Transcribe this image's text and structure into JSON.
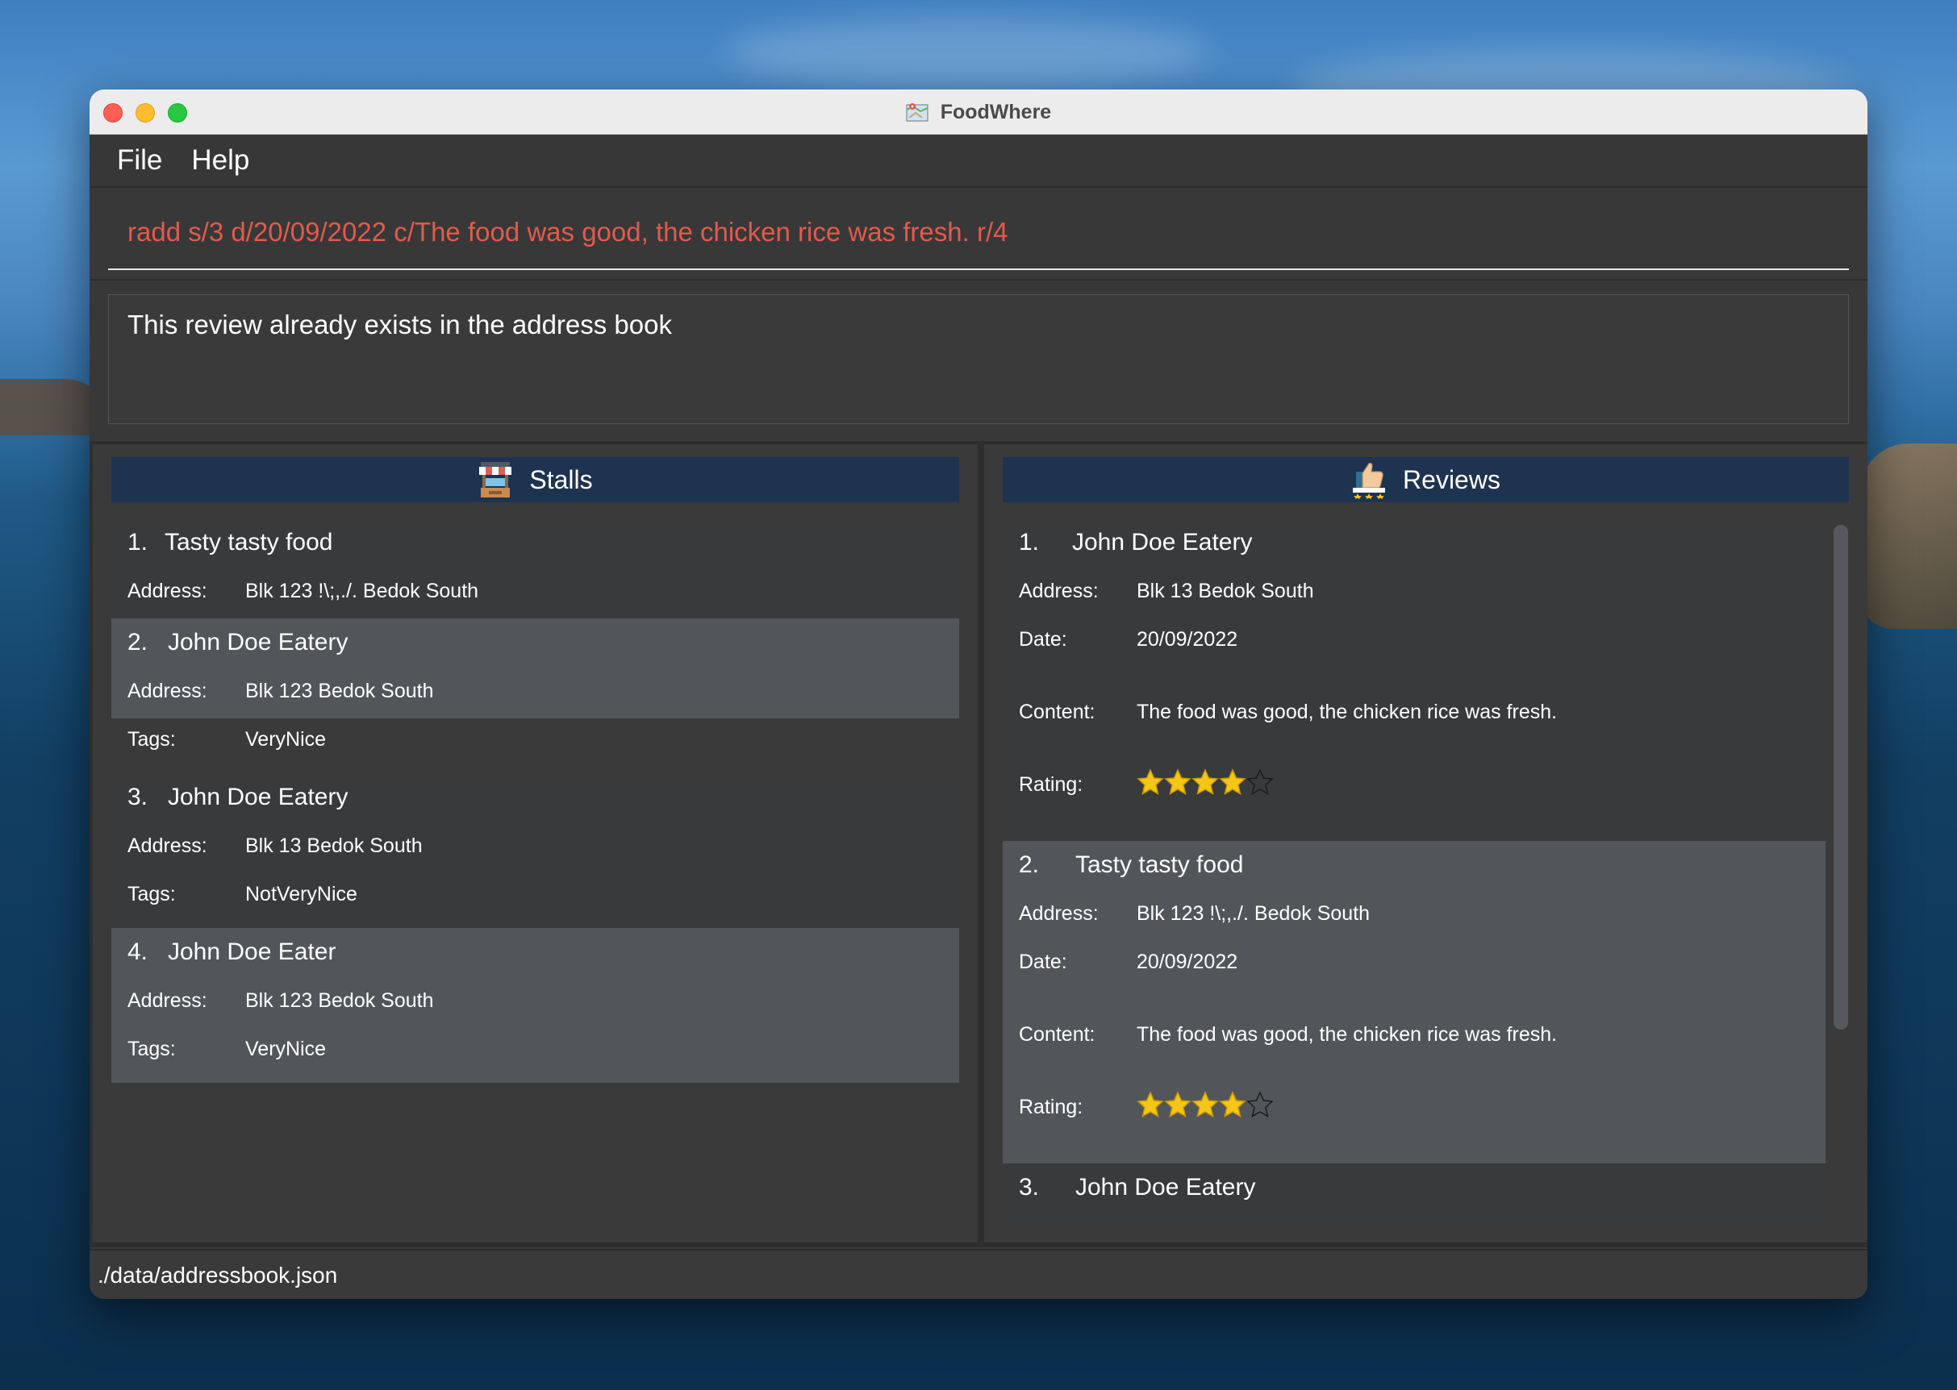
{
  "window": {
    "title": "FoodWhere",
    "app_icon": "map-icon"
  },
  "menu": {
    "file": "File",
    "help": "Help"
  },
  "command": {
    "value": "radd s/3 d/20/09/2022 c/The food was good, the chicken rice was fresh. r/4",
    "error_color": "#e35a4c"
  },
  "result": {
    "message": "This review already exists in the address book"
  },
  "stalls": {
    "header": "Stalls",
    "header_icon": "food-stall-icon",
    "address_label": "Address:",
    "tags_label": "Tags:",
    "items": [
      {
        "index": "1.",
        "name": "Tasty tasty food",
        "address": "Blk 123 !\\;,./. Bedok South",
        "tags": ""
      },
      {
        "index": "2.",
        "name": "John Doe Eatery",
        "address": "Blk 123 Bedok South",
        "tags": "VeryNice"
      },
      {
        "index": "3.",
        "name": "John Doe Eatery",
        "address": "Blk 13 Bedok South",
        "tags": "NotVeryNice"
      },
      {
        "index": "4.",
        "name": "John Doe Eater",
        "address": "Blk 123 Bedok South",
        "tags": "VeryNice"
      }
    ]
  },
  "reviews": {
    "header": "Reviews",
    "header_icon": "thumbs-up-review-icon",
    "address_label": "Address:",
    "date_label": "Date:",
    "content_label": "Content:",
    "rating_label": "Rating:",
    "items": [
      {
        "index": "1.",
        "name": "John Doe Eatery",
        "address": "Blk 13 Bedok South",
        "date": "20/09/2022",
        "content": "The food was good, the chicken rice was fresh.",
        "rating": 4,
        "max_rating": 5
      },
      {
        "index": "2.",
        "name": "Tasty tasty food",
        "address": "Blk 123 !\\;,./. Bedok South",
        "date": "20/09/2022",
        "content": "The food was good, the chicken rice was fresh.",
        "rating": 4,
        "max_rating": 5
      },
      {
        "index": "3.",
        "name": "John Doe Eatery"
      }
    ]
  },
  "status": {
    "path": "./data/addressbook.json"
  },
  "colors": {
    "header_bg": "#1e3350",
    "star_fill": "#f5c518",
    "window_bg": "#3b3b3b"
  }
}
